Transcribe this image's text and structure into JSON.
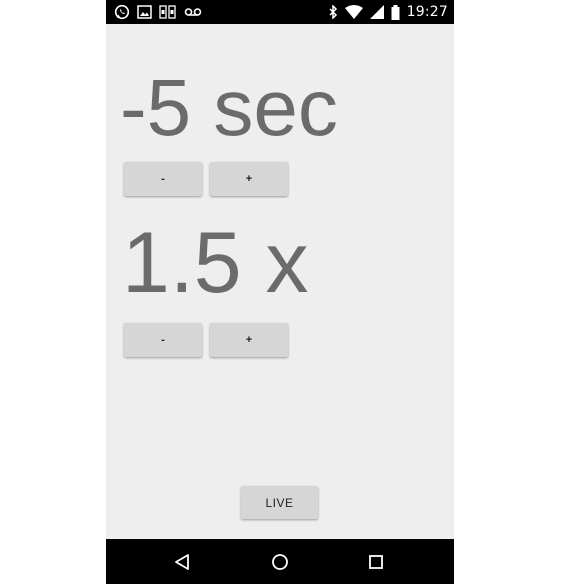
{
  "status_bar": {
    "time": "19:27",
    "left_icons": [
      "whatsapp-icon",
      "image-icon",
      "sim-card-icon",
      "voicemail-icon"
    ],
    "right_icons": [
      "bluetooth-icon",
      "wifi-icon",
      "cell-signal-icon",
      "battery-icon"
    ]
  },
  "main": {
    "offset_display": "-5 sec",
    "offset_minus_label": "-",
    "offset_plus_label": "+",
    "rate_display": "1.5 x",
    "rate_minus_label": "-",
    "rate_plus_label": "+",
    "live_label": "LIVE"
  },
  "nav_bar": {
    "icons": [
      "back-icon",
      "home-icon",
      "recent-apps-icon"
    ]
  },
  "colors": {
    "background": "#eeeeee",
    "display_text": "#6b6b6b",
    "button": "#d6d6d6",
    "bars": "#000000"
  }
}
